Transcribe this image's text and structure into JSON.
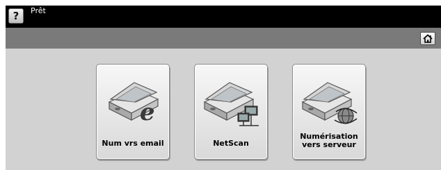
{
  "header": {
    "help_label": "?",
    "status": "Prêt"
  },
  "toolbar": {
    "home_icon": "home-icon"
  },
  "tiles": [
    {
      "label": "Num vrs email",
      "icon": "scanner-email-icon"
    },
    {
      "label": "NetScan",
      "icon": "scanner-network-icon"
    },
    {
      "label": "Numérisation\nvers serveur",
      "icon": "scanner-server-icon"
    }
  ]
}
